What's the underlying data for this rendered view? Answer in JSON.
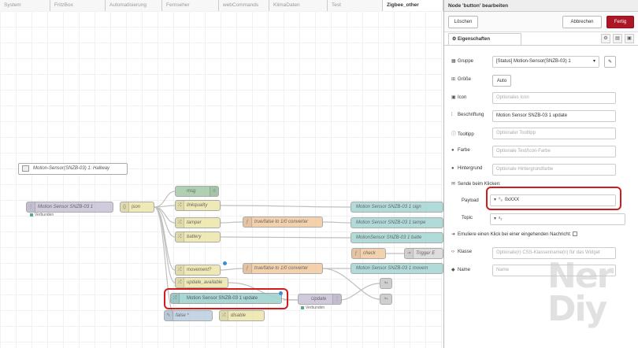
{
  "tabs": [
    "System",
    "FritzBox",
    "Automatisierung",
    "Fernseher",
    "webCommands",
    "KlimaDaten",
    "Test",
    "Zigbee_other"
  ],
  "flow": {
    "group_label": "Motion-Sensor(SNZB-03) 1: Hallway",
    "nodes": {
      "mqtt_in": "Motion Sensor SNZB-03 1",
      "mqtt_in_status": "Verbunden",
      "json": "json",
      "msg": "msg",
      "linkquality": "linkquality",
      "tamper": "tamper",
      "battery": "battery",
      "movement": "movement?",
      "update_available": "update_available",
      "conv1": "true/false to 1/0 converter",
      "conv2": "true/false to 1/0 converter",
      "out1": "Motion Sensor SNZB-03 1 sign",
      "out2": "Motion Sensor SNZB-03 1 tampe",
      "out3": "MotionSensor SNZB-03 1 batte",
      "check": "check",
      "trigger": "Trigger E",
      "out4": "Motion Sensor SNZB-03 1 movem",
      "button": "Motion Sensor SNZB-03 1 update",
      "update": "Update",
      "update_status": "Verbunden",
      "false_node": "false *",
      "disable": "disable"
    }
  },
  "panel": {
    "title": "Node 'button' bearbeiten",
    "delete_label": "Löschen",
    "cancel_label": "Abbrechen",
    "done_label": "Fertig",
    "props_tab": "Eigenschaften",
    "fields": {
      "group": {
        "label": "Gruppe",
        "value": "[Status] Motion-Sensor(SNZB-03) 1"
      },
      "size": {
        "label": "Größe",
        "value": "Auto"
      },
      "icon": {
        "label": "Icon",
        "placeholder": "Optionales Icon"
      },
      "caption": {
        "label": "Beschriftung",
        "value": "Motion Sensor SNZB-03 1 update"
      },
      "tooltip": {
        "label": "Tooltipp",
        "placeholder": "Optionaler Tooltipp"
      },
      "color": {
        "label": "Farbe",
        "placeholder": "Optionale Text/Icon-Farbe"
      },
      "background": {
        "label": "Hintergrund",
        "placeholder": "Optionale Hintergrundfarbe"
      },
      "send_on_click": {
        "label": "Sende beim Klicken:"
      },
      "payload": {
        "label": "Payload",
        "type_glyph": "⁰₉",
        "value": "0xXXX"
      },
      "topic": {
        "label": "Topic",
        "type_glyph": "ᵃ₂"
      },
      "emulate": {
        "label": "Emuliere einen Klick bei einer eingehenden Nachricht:"
      },
      "class": {
        "label": "Klasse",
        "placeholder": "Optionale(r) CSS-Klassenname(n) für das Widget"
      },
      "name": {
        "label": "Name",
        "placeholder": "Name"
      }
    }
  },
  "watermark": "Ner\nDiy"
}
